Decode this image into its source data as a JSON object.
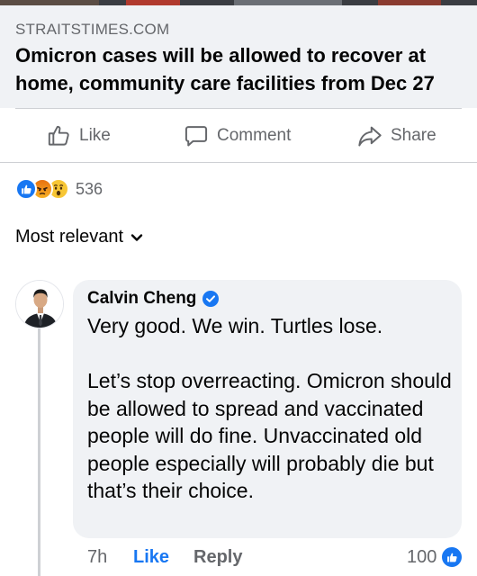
{
  "link_preview": {
    "source": "STRAITSTIMES.COM",
    "title": "Omicron cases will be allowed to recover at home, community care facilities from Dec 27"
  },
  "actions": {
    "like": "Like",
    "comment": "Comment",
    "share": "Share"
  },
  "reactions": {
    "icons": [
      "like-icon",
      "angry-icon",
      "wow-icon"
    ],
    "count": "536"
  },
  "sort": {
    "label": "Most relevant"
  },
  "comment": {
    "author": "Calvin Cheng",
    "verified": true,
    "text": "Very good. We win. Turtles lose.\n\nLet’s stop overreacting. Omicron should be allowed to spread and vaccinated people will do fine. Unvaccinated old people especially will probably die but that’s their choice.",
    "time": "7h",
    "like_label": "Like",
    "reply_label": "Reply",
    "reaction_count": "100"
  },
  "colors": {
    "accent": "#1877f2",
    "muted_text": "#65676b",
    "bubble_bg": "#f0f2f5"
  }
}
